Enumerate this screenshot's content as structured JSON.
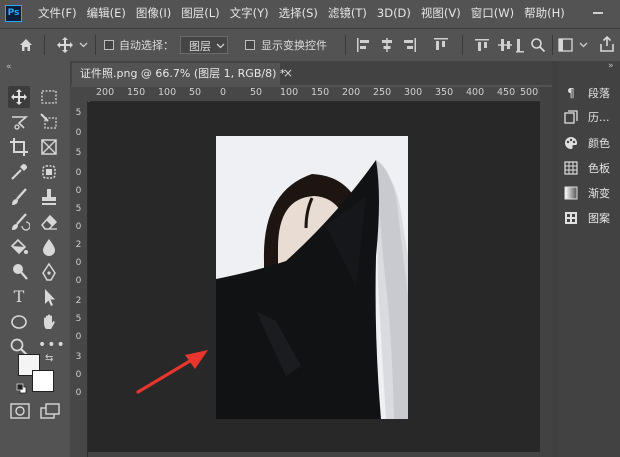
{
  "app": {
    "logo_text": "Ps"
  },
  "menu": [
    "文件(F)",
    "编辑(E)",
    "图像(I)",
    "图层(L)",
    "文字(Y)",
    "选择(S)",
    "滤镜(T)",
    "3D(D)",
    "视图(V)",
    "窗口(W)",
    "帮助(H)"
  ],
  "options_bar": {
    "auto_select_label": "自动选择：",
    "auto_select_checked": false,
    "layer_select_value": "图层",
    "show_transform_label": "显示变换控件",
    "show_transform_checked": false
  },
  "document": {
    "tab_title": "证件照.png @ 66.7% (图层 1, RGB/8) *",
    "tab_close": "×"
  },
  "ruler_h_ticks": [
    "200",
    "150",
    "100",
    "50",
    "0",
    "50",
    "100",
    "150",
    "200",
    "250",
    "300",
    "350",
    "400",
    "450",
    "500"
  ],
  "ruler_v_ticks": [
    "5",
    "0",
    "5",
    "0",
    "0",
    "5",
    "0",
    "2",
    "0",
    "0",
    "2",
    "5",
    "0",
    "3",
    "0",
    "0"
  ],
  "right_panel": [
    {
      "label": "段落",
      "icon": "paragraph-icon"
    },
    {
      "label": "历...",
      "icon": "history-icon"
    },
    {
      "label": "颜色",
      "icon": "color-icon"
    },
    {
      "label": "色板",
      "icon": "swatches-icon"
    },
    {
      "label": "渐变",
      "icon": "gradient-icon"
    },
    {
      "label": "图案",
      "icon": "patterns-icon"
    }
  ],
  "colors": {
    "foreground": "#f4f4f4",
    "background": "#ffffff",
    "arrow": "#e8352d",
    "ps_blue": "#31a8ff"
  }
}
